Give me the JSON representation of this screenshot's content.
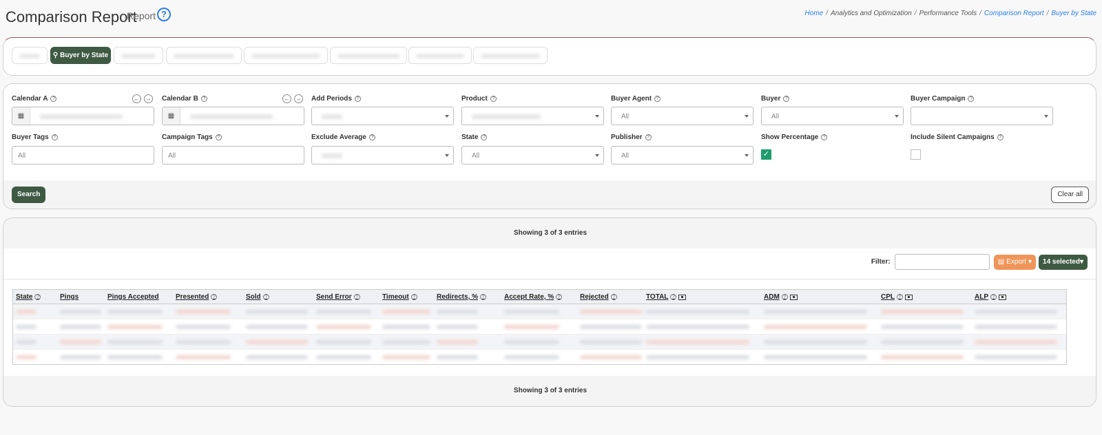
{
  "header": {
    "title": "Comparison Report",
    "subtitle": "Report",
    "help_icon": "question-circle-icon",
    "breadcrumb": [
      "Home",
      "Analytics and Optimization",
      "Performance Tools",
      "Comparison Report",
      "Buyer by State"
    ]
  },
  "tabs": {
    "active_label": "Buyer by State",
    "active_icon": "pin-icon"
  },
  "filters": {
    "calendar_a": "Calendar A",
    "calendar_b": "Calendar B",
    "add_periods": "Add Periods",
    "product": "Product",
    "buyer_agent": "Buyer Agent",
    "buyer_agent_value": "All",
    "buyer": "Buyer",
    "buyer_value": "All",
    "buyer_campaign": "Buyer Campaign",
    "buyer_tags": "Buyer Tags",
    "buyer_tags_value": "All",
    "campaign_tags": "Campaign Tags",
    "campaign_tags_value": "All",
    "exclude_average": "Exclude Average",
    "state": "State",
    "state_value": "All",
    "publisher": "Publisher",
    "publisher_value": "All",
    "show_percentage": "Show Percentage",
    "show_percentage_checked": true,
    "include_silent": "Include Silent Campaigns",
    "include_silent_checked": false,
    "search_button": "Search",
    "clear_button": "Clear all"
  },
  "table": {
    "showing_top": "Showing 3 of 3 entries",
    "showing_bottom": "Showing 3 of 3 entries",
    "filter_label": "Filter:",
    "export_label": "Export",
    "selected_label": "14 selected",
    "columns": [
      "State",
      "Pings",
      "Pings Accepted",
      "Presented",
      "Sold",
      "Send Error",
      "Timeout",
      "Redirects, %",
      "Accept Rate, %",
      "Rejected",
      "TOTAL",
      "ADM",
      "CPL",
      "ALP"
    ]
  },
  "colors": {
    "primary": "#3e5a43",
    "export": "#f0955a",
    "check": "#1e9e6f",
    "link": "#2a7ee8"
  }
}
